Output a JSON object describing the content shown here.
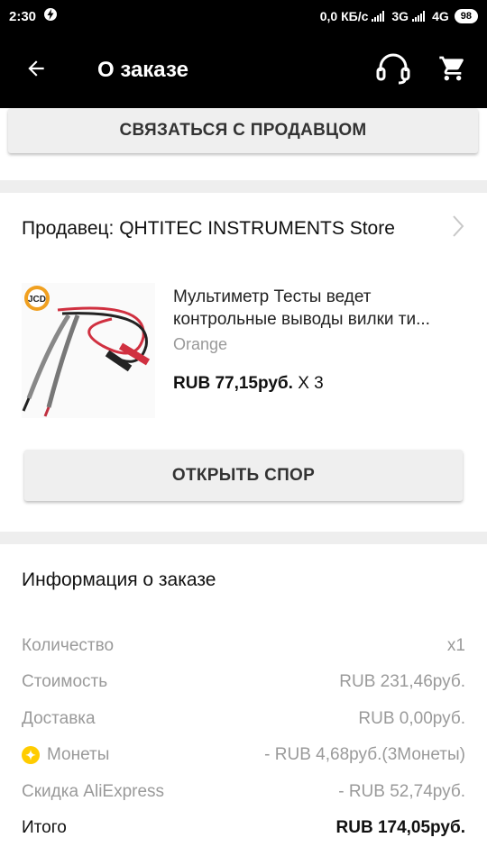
{
  "status_bar": {
    "time": "2:30",
    "network_speed": "0,0 КБ/с",
    "network_1": "3G",
    "network_2": "4G",
    "battery": "98"
  },
  "app_bar": {
    "title": "О заказе",
    "back_icon": "arrow-left-icon",
    "support_icon": "headset-icon",
    "cart_icon": "cart-icon"
  },
  "contact_seller_button": "СВЯЗАТЬСЯ С ПРОДАВЦОМ",
  "seller": {
    "label": "Продавец: QHTITEC INSTRUMENTS Store"
  },
  "product": {
    "title_line1": "Мультиметр Тесты ведет",
    "title_line2": "контрольные выводы вилки ти...",
    "color": "Orange",
    "price": "RUB 77,15руб.",
    "quantity": "X 3",
    "image_logo": "JCD"
  },
  "open_dispute_button": "ОТКРЫТЬ СПОР",
  "order_info": {
    "title": "Информация о заказе",
    "rows": [
      {
        "label": "Количество",
        "value": "x1"
      },
      {
        "label": "Стоимость",
        "value": "RUB 231,46руб."
      },
      {
        "label": "Доставка",
        "value": "RUB 0,00руб."
      },
      {
        "label": "Монеты",
        "value": "- RUB 4,68руб.(3Монеты)"
      },
      {
        "label": "Скидка AliExpress",
        "value": "- RUB 52,74руб."
      },
      {
        "label": "Итого",
        "value": "RUB 174,05руб."
      }
    ]
  },
  "colors": {
    "app_bar_bg": "#000000",
    "coin": "#ffcc00",
    "muted_text": "#9a9a9a"
  }
}
